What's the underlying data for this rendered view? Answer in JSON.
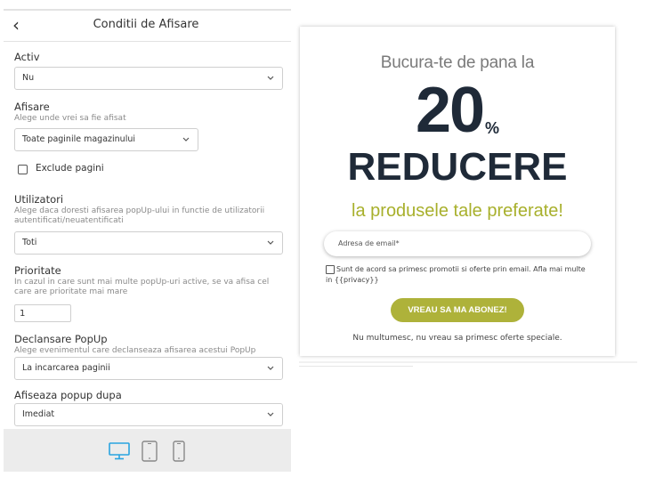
{
  "panel": {
    "title": "Conditii de Afisare",
    "back_icon": "chevron-left-icon",
    "fields": {
      "activ": {
        "label": "Activ",
        "value": "Nu"
      },
      "afisare": {
        "label": "Afisare",
        "help": "Alege unde vrei sa fie afisat",
        "value": "Toate paginile magazinului"
      },
      "exclude": {
        "label": "Exclude pagini",
        "checked": false
      },
      "utilizatori": {
        "label": "Utilizatori",
        "help": "Alege daca doresti afisarea popUp-ului in functie de utilizatorii autentificati/neuatentificati",
        "value": "Toti"
      },
      "prioritate": {
        "label": "Prioritate",
        "help": "In cazul in care sunt mai multe popUp-uri active, se va afisa cel care are prioritate mai mare",
        "value": "1"
      },
      "declansare": {
        "label": "Declansare PopUp",
        "help": "Alege evenimentul care declanseaza afisarea acestui PopUp",
        "value": "La incarcarea paginii"
      },
      "afiseaza_dupa": {
        "label": "Afiseaza popup dupa",
        "value": "Imediat"
      }
    },
    "devices": [
      {
        "name": "desktop-icon",
        "active": true
      },
      {
        "name": "tablet-icon",
        "active": false
      },
      {
        "name": "mobile-icon",
        "active": false
      }
    ],
    "colors": {
      "active_device": "#2aa3e0",
      "inactive_device": "#888888",
      "device_bar": "#ececec"
    }
  },
  "popup": {
    "heading": "Bucura-te de pana la",
    "number": "20",
    "percent_sign": "%",
    "discount": "REDUCERE",
    "subheading": "la produsele tale preferate!",
    "email_placeholder": "Adresa de email*",
    "consent": "Sunt de acord sa primesc promotii si oferte prin email. Afla mai multe in {{privacy}}",
    "consent_checked": false,
    "subscribe_label": "VREAU SA MA ABONEZ!",
    "decline_text": "Nu multumesc, nu vreau sa primesc oferte speciale.",
    "colors": {
      "accent": "#aeb23a",
      "dark_text": "#1f2a38",
      "heading": "#7a7a7a"
    }
  }
}
